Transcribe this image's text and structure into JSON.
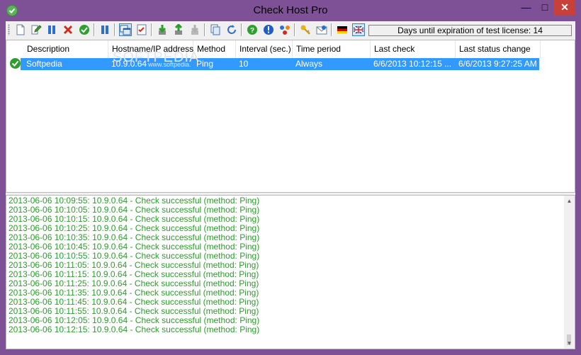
{
  "window": {
    "title": "Check Host Pro"
  },
  "titlebar_buttons": {
    "minimize": "—",
    "maximize": "□",
    "close": "✕"
  },
  "toolbar": {
    "buttons": [
      {
        "name": "new-host-icon",
        "tip": "new"
      },
      {
        "name": "edit-host-icon",
        "tip": "edit"
      },
      {
        "name": "pause-host-icon",
        "tip": "pause"
      },
      {
        "name": "delete-host-icon",
        "tip": "delete"
      },
      {
        "name": "check-now-icon",
        "tip": "check"
      },
      {
        "name": "pause-all-icon",
        "tip": "pause all"
      },
      {
        "name": "window-view-icon",
        "tip": "view"
      },
      {
        "name": "checklist-icon",
        "tip": "checklist"
      },
      {
        "name": "import-icon",
        "tip": "import"
      },
      {
        "name": "export-icon",
        "tip": "export"
      },
      {
        "name": "export-disabled-icon",
        "tip": "export disabled"
      },
      {
        "name": "copy-icon",
        "tip": "copy"
      },
      {
        "name": "refresh-icon",
        "tip": "refresh"
      },
      {
        "name": "help-icon",
        "tip": "help"
      },
      {
        "name": "info-icon",
        "tip": "info"
      },
      {
        "name": "network-icon",
        "tip": "network"
      },
      {
        "name": "key-icon",
        "tip": "license"
      },
      {
        "name": "email-icon",
        "tip": "email"
      },
      {
        "name": "german-flag-icon",
        "tip": "german"
      },
      {
        "name": "english-flag-icon",
        "tip": "english"
      }
    ],
    "license_text": "Days until expiration of test license: 14"
  },
  "hosts_table": {
    "columns": [
      "Description",
      "Hostname/IP address",
      "Method",
      "Interval (sec.)",
      "Time period",
      "Last check",
      "Last status change"
    ],
    "rows": [
      {
        "description": "Softpedia",
        "hostname": "10.9.0.64",
        "method": "Ping",
        "interval": "10",
        "time_period": "Always",
        "last_check": "6/6/2013 10:12:15 ...",
        "last_status_change": "6/6/2013 9:27:25 AM"
      }
    ]
  },
  "watermark": "SOFTPEDIA",
  "watermark_small": "www.softpedia.com",
  "log": {
    "lines": [
      "2013-06-06 10:09:55: 10.9.0.64 - Check successful (method: Ping)",
      "2013-06-06 10:10:05: 10.9.0.64 - Check successful (method: Ping)",
      "2013-06-06 10:10:15: 10.9.0.64 - Check successful (method: Ping)",
      "2013-06-06 10:10:25: 10.9.0.64 - Check successful (method: Ping)",
      "2013-06-06 10:10:35: 10.9.0.64 - Check successful (method: Ping)",
      "2013-06-06 10:10:45: 10.9.0.64 - Check successful (method: Ping)",
      "2013-06-06 10:10:55: 10.9.0.64 - Check successful (method: Ping)",
      "2013-06-06 10:11:05: 10.9.0.64 - Check successful (method: Ping)",
      "2013-06-06 10:11:15: 10.9.0.64 - Check successful (method: Ping)",
      "2013-06-06 10:11:25: 10.9.0.64 - Check successful (method: Ping)",
      "2013-06-06 10:11:35: 10.9.0.64 - Check successful (method: Ping)",
      "2013-06-06 10:11:45: 10.9.0.64 - Check successful (method: Ping)",
      "2013-06-06 10:11:55: 10.9.0.64 - Check successful (method: Ping)",
      "2013-06-06 10:12:05: 10.9.0.64 - Check successful (method: Ping)",
      "2013-06-06 10:12:15: 10.9.0.64 - Check successful (method: Ping)"
    ]
  },
  "colors": {
    "frame": "#7e5197",
    "selection": "#3399ff",
    "log_text": "#2f9a2f",
    "close": "#c7413a"
  }
}
